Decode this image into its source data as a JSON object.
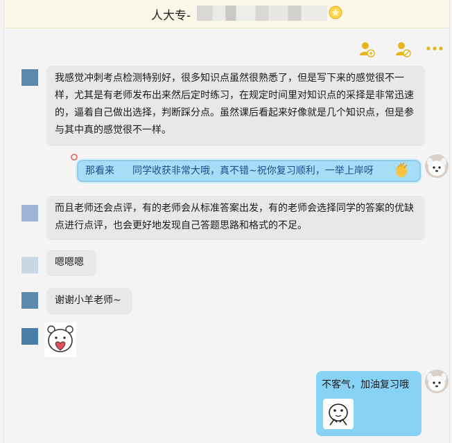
{
  "header": {
    "title_prefix": "人大专-",
    "title_blurred": true,
    "icons": [
      "star-icon"
    ]
  },
  "toolbar": {
    "icons": [
      "add-member-icon",
      "remove-member-icon",
      "more-icon"
    ]
  },
  "messages": [
    {
      "side": "left",
      "text": "我感觉冲刺考点检测特别好，很多知识点虽然很熟悉了，但是写下来的感觉很不一样，尤其是有老师发布出来然后定时练习，在规定时间里对知识点的采择是非常迅速的，逼着自己做出选择，判断踩分点。虽然课后看起来好像就是几个知识点，但是参与其中真的感觉很不一样。"
    },
    {
      "side": "right",
      "style": "pill",
      "text_before": "那看来",
      "text_after": "同学收获非常大哦，真不错~祝你复习顺利，一举上岸呀"
    },
    {
      "side": "left",
      "text": "而且老师还会点评，有的老师会从标准答案出发，有的老师会选择同学的答案的优缺点进行点评，也会更好地发现自己答题思路和格式的不足。"
    },
    {
      "side": "left",
      "text": "嗯嗯嗯"
    },
    {
      "side": "left",
      "text": "谢谢小羊老师~"
    },
    {
      "side": "left",
      "type": "sticker",
      "name": "bear-heart-sticker"
    },
    {
      "side": "right",
      "text": "不客气，加油复习哦",
      "sticker": "thumbs-up-sticker"
    }
  ],
  "colors": {
    "left_bubble": "#e8e8e8",
    "right_bubble": "#87d2f5",
    "titlebar": "#fbf7e8",
    "pill_text": "#1b4f8c"
  }
}
